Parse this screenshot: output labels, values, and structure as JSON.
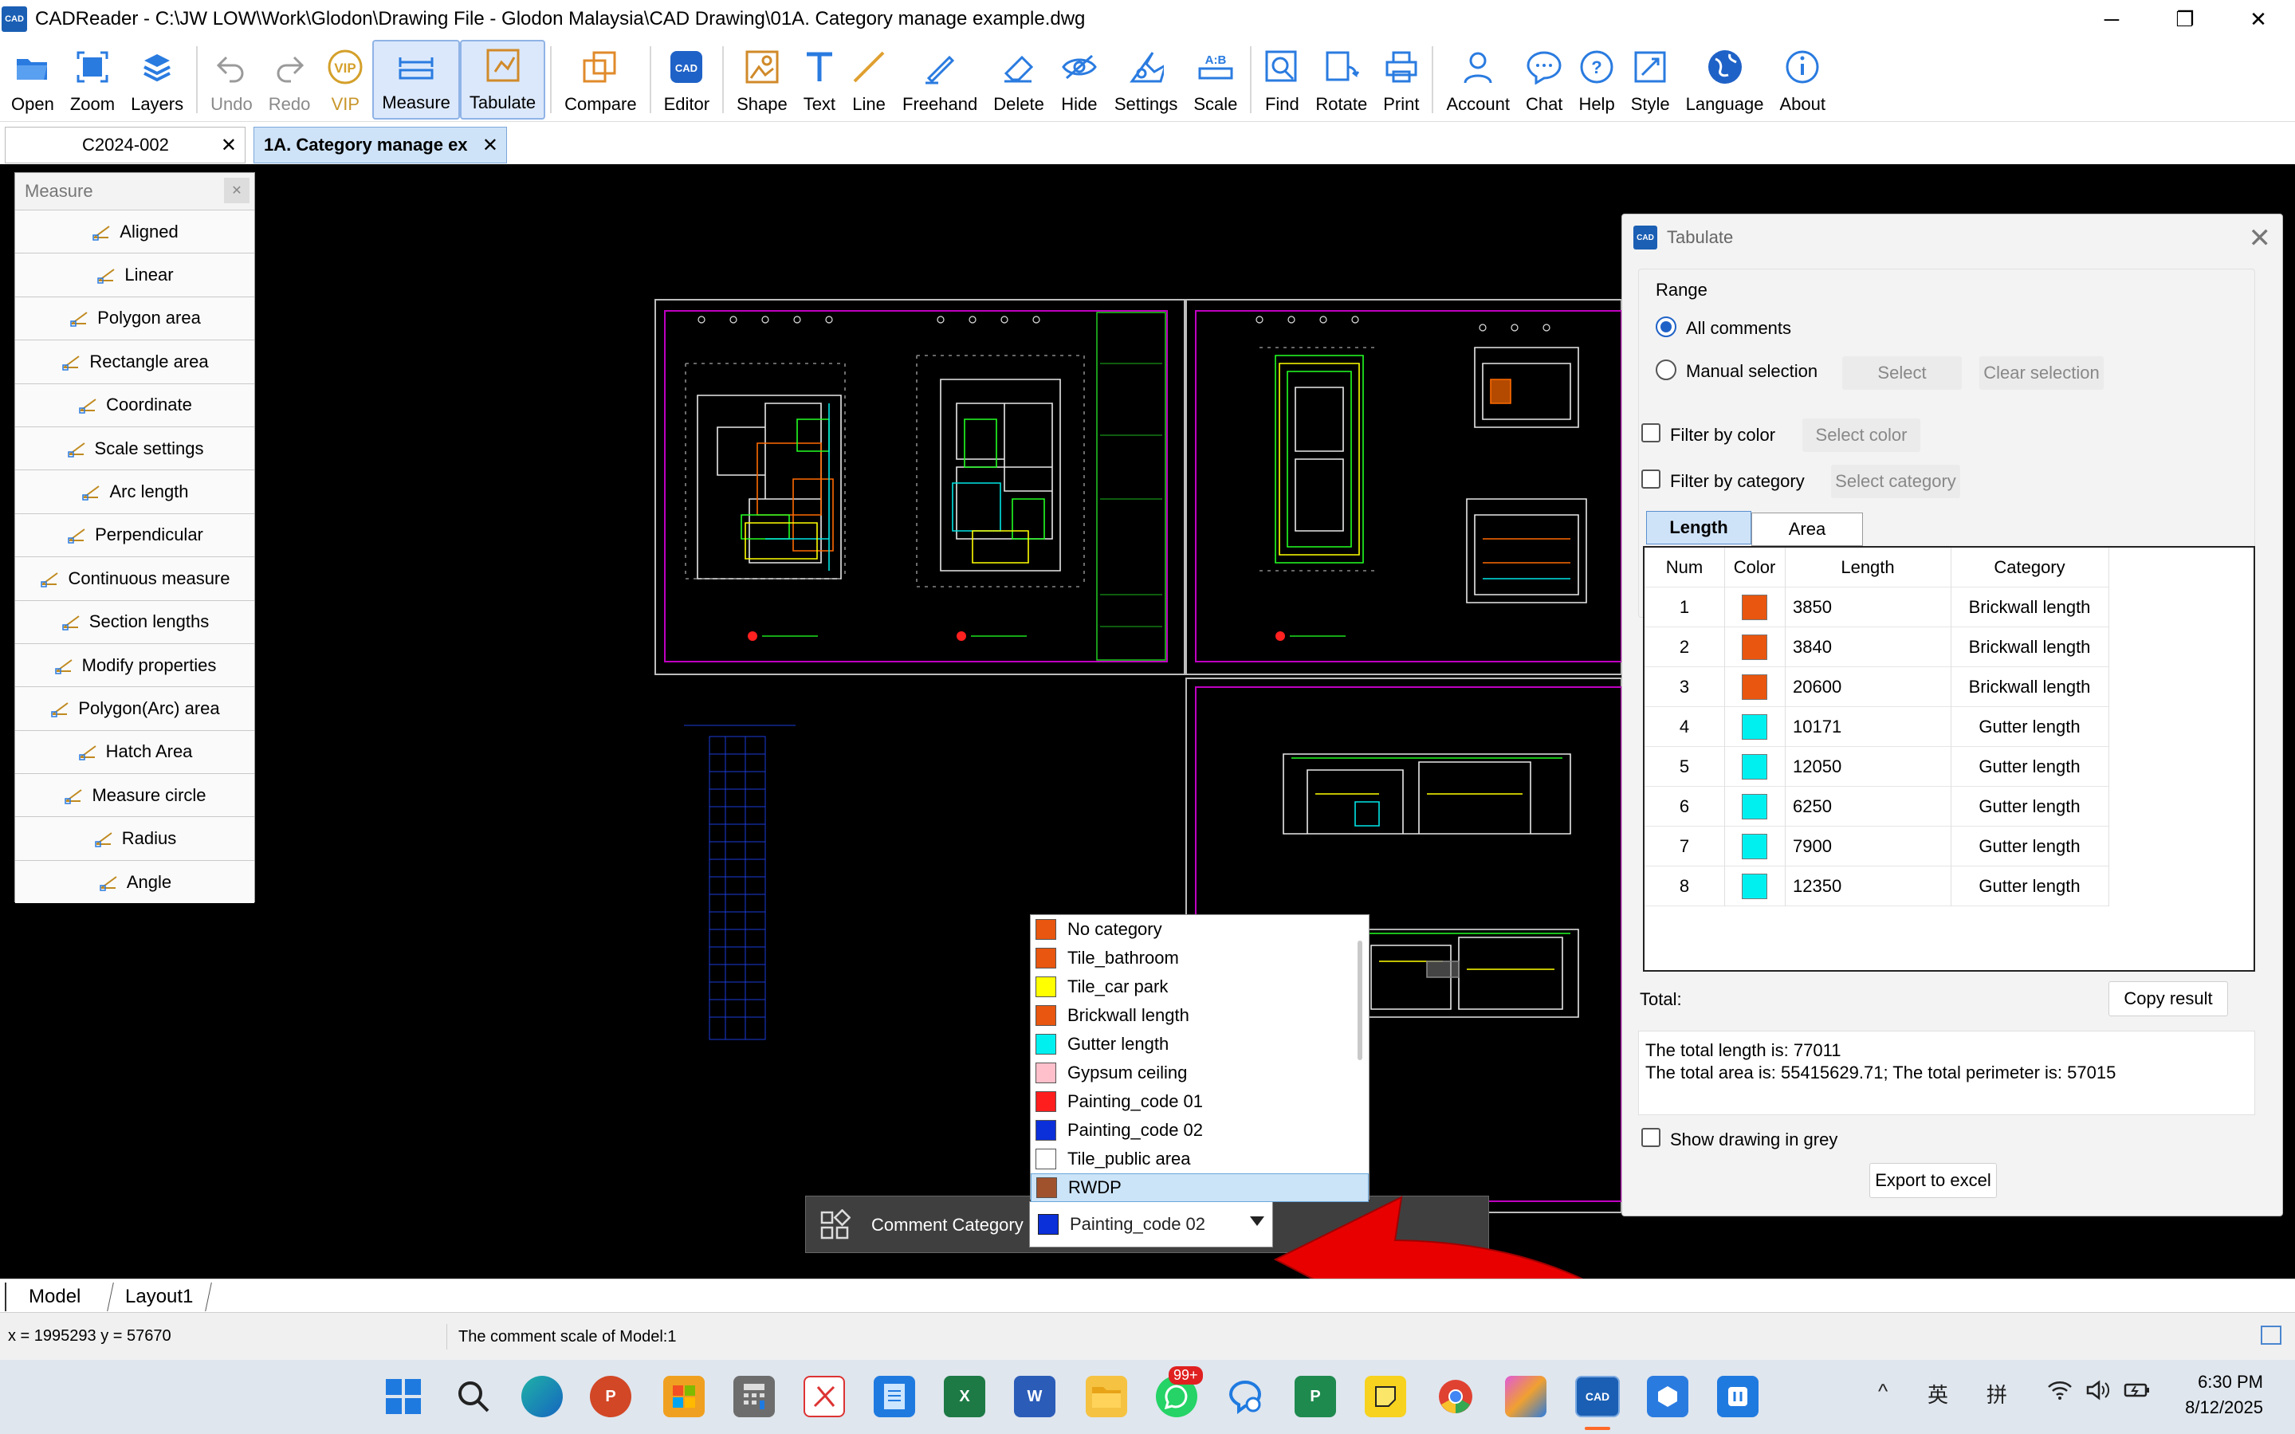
{
  "window": {
    "title": "CADReader - C:\\JW LOW\\Work\\Glodon\\Drawing File - Glodon Malaysia\\CAD Drawing\\01A. Category manage example.dwg",
    "app_icon_text": "CAD",
    "minimize": "─",
    "maximize": "❐",
    "close": "✕"
  },
  "ribbon": {
    "open": "Open",
    "zoom": "Zoom",
    "layers": "Layers",
    "undo": "Undo",
    "redo": "Redo",
    "vip": "VIP",
    "measure": "Measure",
    "tabulate": "Tabulate",
    "compare": "Compare",
    "editor": "Editor",
    "shape": "Shape",
    "text": "Text",
    "line": "Line",
    "freehand": "Freehand",
    "delete": "Delete",
    "hide": "Hide",
    "settings": "Settings",
    "scale": "Scale",
    "find": "Find",
    "rotate": "Rotate",
    "print": "Print",
    "account": "Account",
    "chat": "Chat",
    "help": "Help",
    "style": "Style",
    "language": "Language",
    "about": "About"
  },
  "doc_tabs": [
    {
      "label": "C2024-002",
      "active": false
    },
    {
      "label": "1A. Category manage ex",
      "active": true
    }
  ],
  "measure_panel": {
    "title": "Measure",
    "close": "✕",
    "items": [
      {
        "label": "Aligned",
        "icon": "aligned-icon"
      },
      {
        "label": "Linear",
        "icon": "linear-icon"
      },
      {
        "label": "Polygon area",
        "icon": "polygon-area-icon"
      },
      {
        "label": "Rectangle area",
        "icon": "rectangle-area-icon"
      },
      {
        "label": "Coordinate",
        "icon": "coordinate-icon"
      },
      {
        "label": "Scale settings",
        "icon": "scale-settings-icon"
      },
      {
        "label": "Arc length",
        "icon": "arc-length-icon"
      },
      {
        "label": "Perpendicular",
        "icon": "perpendicular-icon"
      },
      {
        "label": "Continuous measure",
        "icon": "continuous-measure-icon"
      },
      {
        "label": "Section lengths",
        "icon": "section-lengths-icon"
      },
      {
        "label": "Modify properties",
        "icon": "modify-properties-icon"
      },
      {
        "label": "Polygon(Arc) area",
        "icon": "polygon-arc-area-icon"
      },
      {
        "label": "Hatch Area",
        "icon": "hatch-area-icon"
      },
      {
        "label": "Measure circle",
        "icon": "measure-circle-icon"
      },
      {
        "label": "Radius",
        "icon": "radius-icon"
      },
      {
        "label": "Angle",
        "icon": "angle-icon"
      }
    ]
  },
  "tabulate": {
    "title": "Tabulate",
    "icon_text": "CAD",
    "close": "✕",
    "range_label": "Range",
    "all_comments": "All comments",
    "manual_selection": "Manual selection",
    "select_btn": "Select",
    "clear_selection_btn": "Clear selection",
    "filter_color": "Filter by color",
    "select_color_btn": "Select color",
    "filter_category": "Filter by category",
    "select_category_btn": "Select category",
    "tab_length": "Length",
    "tab_area": "Area",
    "columns": {
      "num": "Num",
      "color": "Color",
      "length": "Length",
      "category": "Category"
    },
    "rows": [
      {
        "num": "1",
        "color": "#e8560f",
        "length": "3850",
        "category": "Brickwall length"
      },
      {
        "num": "2",
        "color": "#e8560f",
        "length": "3840",
        "category": "Brickwall length"
      },
      {
        "num": "3",
        "color": "#e8560f",
        "length": "20600",
        "category": "Brickwall length"
      },
      {
        "num": "4",
        "color": "#00f0f0",
        "length": "10171",
        "category": "Gutter length"
      },
      {
        "num": "5",
        "color": "#00f0f0",
        "length": "12050",
        "category": "Gutter length"
      },
      {
        "num": "6",
        "color": "#00f0f0",
        "length": "6250",
        "category": "Gutter length"
      },
      {
        "num": "7",
        "color": "#00f0f0",
        "length": "7900",
        "category": "Gutter length"
      },
      {
        "num": "8",
        "color": "#00f0f0",
        "length": "12350",
        "category": "Gutter length"
      }
    ],
    "total_label": "Total:",
    "copy_result_btn": "Copy result",
    "total_line1": "The total length is: 77011",
    "total_line2": "The total area is: 55415629.71; The total perimeter is: 57015",
    "show_grey": "Show drawing in grey",
    "export_btn": "Export to excel"
  },
  "category_dropdown": {
    "options": [
      {
        "label": "No category",
        "color": "#e8560f"
      },
      {
        "label": "Tile_bathroom",
        "color": "#e8560f"
      },
      {
        "label": "Tile_car park",
        "color": "#ffff00"
      },
      {
        "label": "Brickwall length",
        "color": "#e8560f"
      },
      {
        "label": "Gutter length",
        "color": "#00f0f0"
      },
      {
        "label": "Gypsum ceiling",
        "color": "#ffc0cb"
      },
      {
        "label": "Painting_code 01",
        "color": "#ff1e1e"
      },
      {
        "label": "Painting_code 02",
        "color": "#0b2fd8"
      },
      {
        "label": "Tile_public area",
        "color": "#ffffff"
      },
      {
        "label": "RWDP",
        "color": "#a0522d"
      }
    ],
    "highlighted": "RWDP"
  },
  "comment_category_bar": {
    "label": "Comment Category",
    "selected": "Painting_code 02",
    "selected_color": "#0b2fd8"
  },
  "layout_tabs": {
    "model": "Model",
    "layout1": "Layout1"
  },
  "status": {
    "coords": "x = 1995293  y = 57670",
    "scale_text": "The comment scale of Model:1"
  },
  "taskbar": {
    "whatsapp_badge": "99+",
    "ime1": "英",
    "ime2": "拼",
    "time": "6:30 PM",
    "date": "8/12/2025"
  },
  "colors": {
    "accent": "#1f62c7",
    "canvas": "#000000",
    "annotation_arrow": "#e00000"
  }
}
